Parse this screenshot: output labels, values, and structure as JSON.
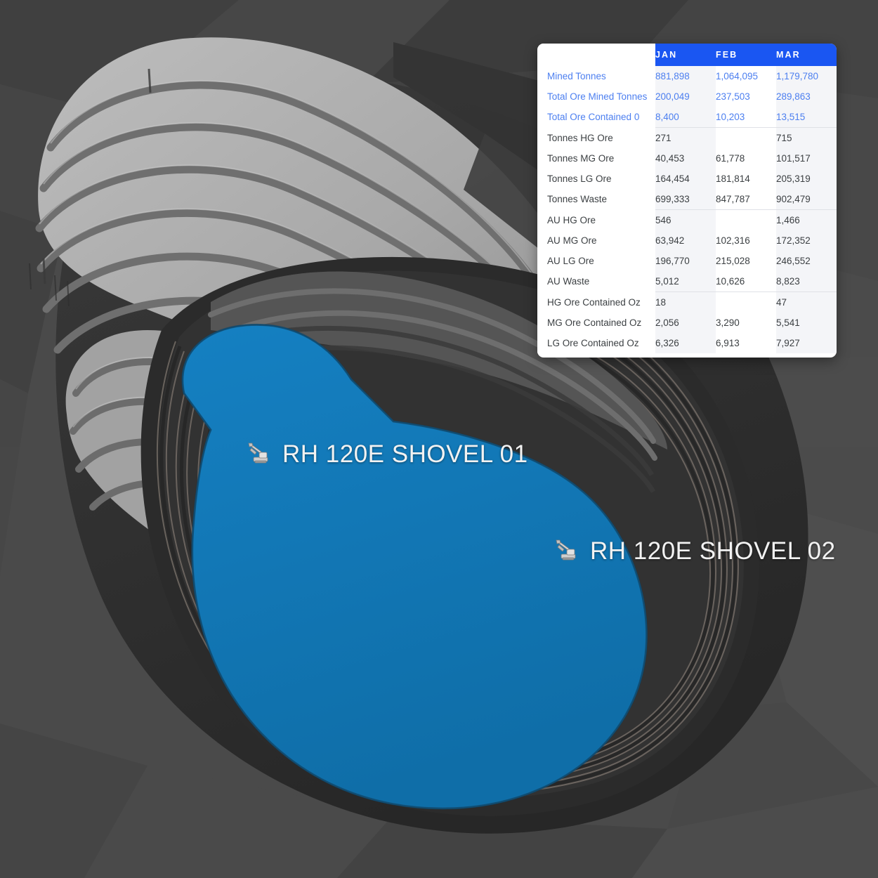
{
  "scene": {
    "background_color": "#4a4a4a",
    "pit_wall_light_color": "#b2b2b2",
    "pit_wall_bench_color": "#6e6e6e",
    "pit_wall_dark_color": "#2e2e2e",
    "ore_block_color": "#1179b8",
    "ore_block_highlight_color": "#1ea3dd",
    "ore_block_edge_color": "#15496d"
  },
  "labels": [
    {
      "id": "shovel-01",
      "text": "RH 120E SHOVEL 01",
      "icon": "excavator-icon"
    },
    {
      "id": "shovel-02",
      "text": "RH 120E SHOVEL 02",
      "icon": "excavator-icon"
    }
  ],
  "panel": {
    "accent_color": "#1a56f2",
    "columns": [
      "JAN",
      "FEB",
      "MAR"
    ],
    "groups": [
      {
        "style": "blue",
        "rows": [
          {
            "label": "Mined Tonnes",
            "values": [
              "881,898",
              "1,064,095",
              "1,179,780"
            ]
          },
          {
            "label": "Total Ore Mined Tonnes",
            "values": [
              "200,049",
              "237,503",
              "289,863"
            ]
          },
          {
            "label": "Total Ore Contained 0",
            "values": [
              "8,400",
              "10,203",
              "13,515"
            ]
          }
        ]
      },
      {
        "style": "normal",
        "rows": [
          {
            "label": "Tonnes HG Ore",
            "values": [
              "271",
              "",
              "715"
            ]
          },
          {
            "label": "Tonnes MG Ore",
            "values": [
              "40,453",
              "61,778",
              "101,517"
            ]
          },
          {
            "label": "Tonnes LG Ore",
            "values": [
              "164,454",
              "181,814",
              "205,319"
            ]
          },
          {
            "label": "Tonnes Waste",
            "values": [
              "699,333",
              "847,787",
              "902,479"
            ]
          }
        ]
      },
      {
        "style": "normal",
        "rows": [
          {
            "label": "AU HG Ore",
            "values": [
              "546",
              "",
              "1,466"
            ]
          },
          {
            "label": "AU MG Ore",
            "values": [
              "63,942",
              "102,316",
              "172,352"
            ]
          },
          {
            "label": "AU LG Ore",
            "values": [
              "196,770",
              "215,028",
              "246,552"
            ]
          },
          {
            "label": "AU Waste",
            "values": [
              "5,012",
              "10,626",
              "8,823"
            ]
          }
        ]
      },
      {
        "style": "normal",
        "rows": [
          {
            "label": "HG Ore Contained Oz",
            "values": [
              "18",
              "",
              "47"
            ]
          },
          {
            "label": "MG Ore Contained Oz",
            "values": [
              "2,056",
              "3,290",
              "5,541"
            ]
          },
          {
            "label": "LG Ore Contained Oz",
            "values": [
              "6,326",
              "6,913",
              "7,927"
            ]
          }
        ]
      }
    ]
  }
}
